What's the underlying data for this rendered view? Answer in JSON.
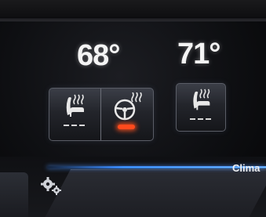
{
  "climate": {
    "driver_temp": "68°",
    "passenger_temp": "71°",
    "tab_label": "Clima",
    "heated_seat_driver": {
      "icon": "heated-seat-icon",
      "level_dashes": 3
    },
    "heated_steering": {
      "icon": "heated-steering-wheel-icon",
      "active": true
    },
    "heated_seat_passenger": {
      "icon": "heated-seat-icon",
      "level_dashes": 3
    }
  },
  "colors": {
    "indicator_active": "#ff4a1c",
    "accent_line": "#3b8cff",
    "text": "#f4f4f4"
  },
  "nav": {
    "settings_icon": "gear-icon"
  }
}
